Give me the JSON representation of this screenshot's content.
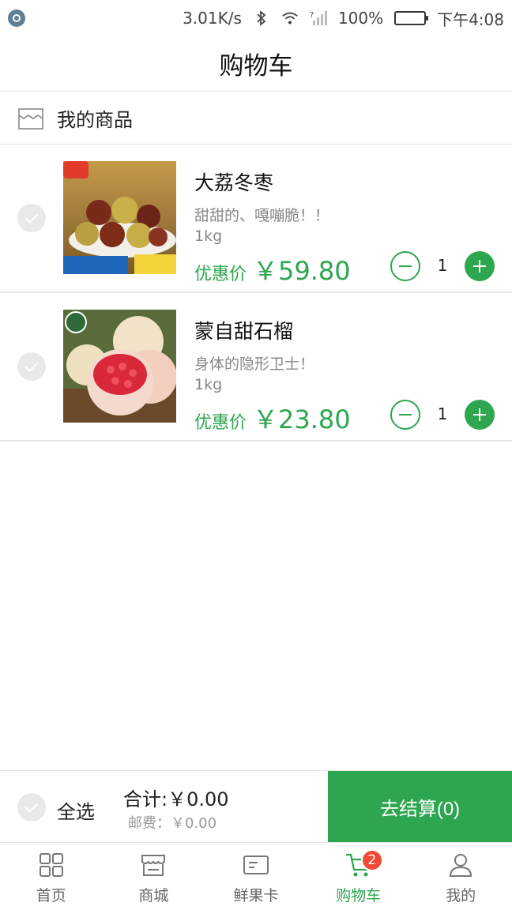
{
  "status_bar": {
    "network_speed": "3.01K/s",
    "battery": "100%",
    "battery_level": 1.0,
    "time": "下午4:08"
  },
  "header": {
    "title": "购物车"
  },
  "section": {
    "title": "我的商品"
  },
  "items": [
    {
      "title": "大荔冬枣",
      "desc": "甜甜的、嘎嘣脆！！",
      "weight": "1kg",
      "price_label": "优惠价",
      "price": "￥59.80",
      "quantity": "1"
    },
    {
      "title": "蒙自甜石榴",
      "desc": "身体的隐形卫士！",
      "weight": "1kg",
      "price_label": "优惠价",
      "price": "￥23.80",
      "quantity": "1"
    }
  ],
  "checkout": {
    "select_all": "全选",
    "total": "合计:￥0.00",
    "shipping": "邮费：￥0.00",
    "button": "去结算(0)"
  },
  "tabs": [
    {
      "label": "首页",
      "icon": "grid-icon"
    },
    {
      "label": "商城",
      "icon": "store-icon"
    },
    {
      "label": "鲜果卡",
      "icon": "card-icon"
    },
    {
      "label": "购物车",
      "icon": "cart-icon",
      "badge": "2",
      "active": true
    },
    {
      "label": "我的",
      "icon": "user-icon"
    }
  ],
  "colors": {
    "accent": "#2ea64f",
    "badge": "#f04a35"
  }
}
